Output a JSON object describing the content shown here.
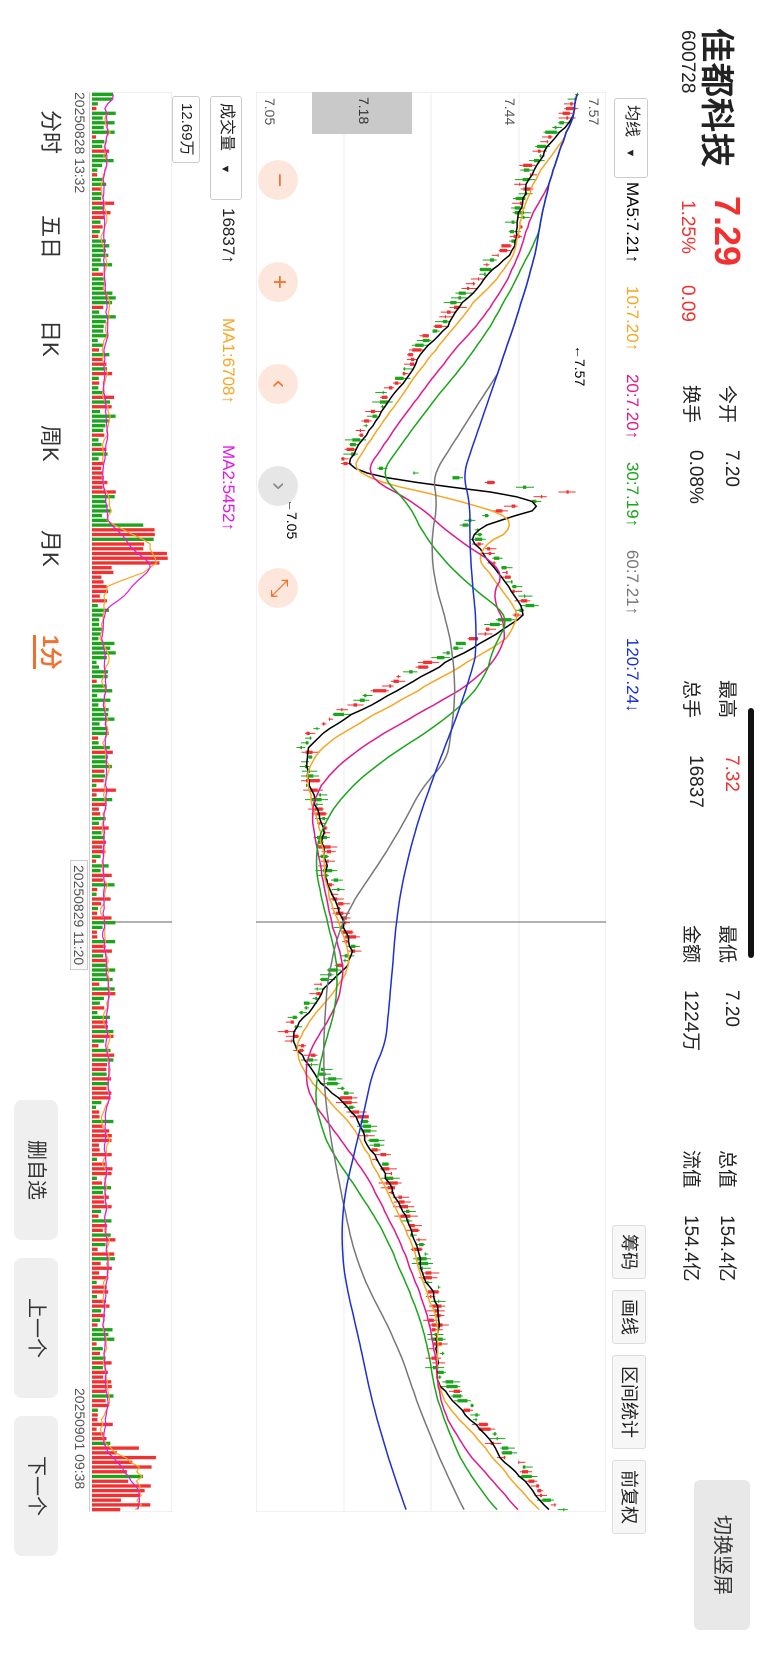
{
  "stock": {
    "name": "佳都科技",
    "code": "600728",
    "price": "7.29",
    "change_pct": "1.25%",
    "change": "0.09"
  },
  "stats": [
    {
      "label": "今开",
      "value": "7.20"
    },
    {
      "label": "最高",
      "value": "7.32"
    },
    {
      "label": "最低",
      "value": "7.20"
    },
    {
      "label": "总值",
      "value": "154.4亿"
    },
    {
      "label": "换手",
      "value": "0.08%"
    },
    {
      "label": "总手",
      "value": "16837"
    },
    {
      "label": "金额",
      "value": "1224万"
    },
    {
      "label": "流值",
      "value": "154.4亿"
    }
  ],
  "switch_button": "切换竖屏",
  "toolbar": {
    "ma_selector": "均线",
    "chip": "筹码",
    "draw": "画线",
    "range_stats": "区间统计",
    "adjust": "前复权"
  },
  "ma_legend": [
    {
      "label": "MA5:7.21↑",
      "color": "#000000"
    },
    {
      "label": "10:7.20↑",
      "color": "#f5a623"
    },
    {
      "label": "20:7.20↑",
      "color": "#e0188c"
    },
    {
      "label": "30:7.19↑",
      "color": "#1aa51a"
    },
    {
      "label": "60:7.21↑",
      "color": "#777777"
    },
    {
      "label": "120:7.24↓",
      "color": "#1a2fd8"
    }
  ],
  "price_axis": {
    "top": "7.57",
    "mid": "7.44",
    "low": "7.05",
    "marker": "7.18"
  },
  "annotations": {
    "high": "←7.57",
    "low": "←7.05"
  },
  "volume": {
    "selector": "成交量",
    "total": "16837↑",
    "ma1": "MA1:6708↑",
    "ma2": "MA2:5452↑",
    "axis_max": "12.69万"
  },
  "time_axis": {
    "start": "20250828 13:32",
    "cross": "20250829 11:20",
    "end": "20250901 09:38"
  },
  "bottom_tabs": [
    "分时",
    "五日",
    "日K",
    "周K",
    "月K",
    "1分"
  ],
  "side_buttons": [
    "删自选",
    "上一个",
    "下一个"
  ],
  "colors": {
    "up": "#f23030",
    "down": "#1aa51a",
    "accent": "#f07030"
  }
}
